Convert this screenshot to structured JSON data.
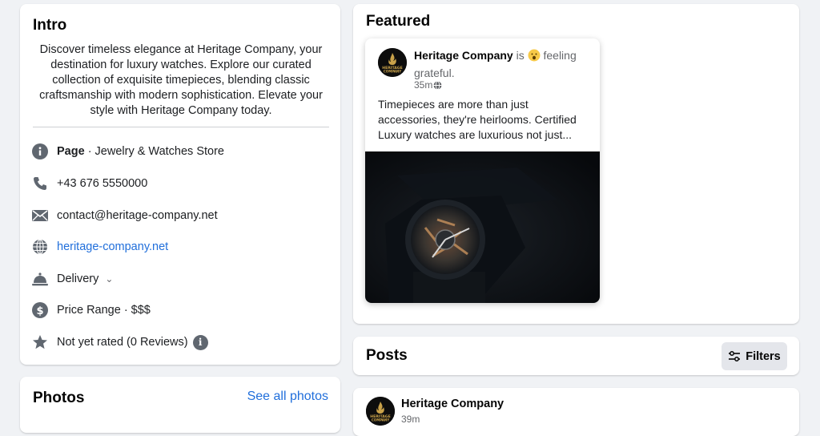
{
  "intro": {
    "title": "Intro",
    "bio": "Discover timeless elegance at Heritage Company, your destination for luxury watches. Explore our curated collection of exquisite timepieces, blending classic craftsmanship with modern sophistication. Elevate your style with Heritage Company today.",
    "page_label": "Page",
    "category": " · Jewelry & Watches Store",
    "phone": "+43 676 5550000",
    "email": "contact@heritage-company.net",
    "website": "heritage-company.net",
    "delivery": "Delivery",
    "price_range": "Price Range · $$$",
    "rating": "Not yet rated (0 Reviews)"
  },
  "photos": {
    "title": "Photos",
    "see_all": "See all photos"
  },
  "featured": {
    "title": "Featured",
    "post": {
      "author": "Heritage Company",
      "is_text": " is ",
      "feeling": "feeling grateful.",
      "time": "35m",
      "body": "Timepieces are more than just accessories, they're heirlooms. Certified Luxury watches are luxurious not just..."
    }
  },
  "posts": {
    "title": "Posts",
    "filters_label": "Filters",
    "first_post": {
      "author": "Heritage Company",
      "time": "39m"
    }
  },
  "brand": {
    "logo_text_top": "HERITAGE",
    "logo_text_bottom": "COMPANY",
    "gold": "#c9a24a",
    "link_blue": "#216fdb"
  }
}
